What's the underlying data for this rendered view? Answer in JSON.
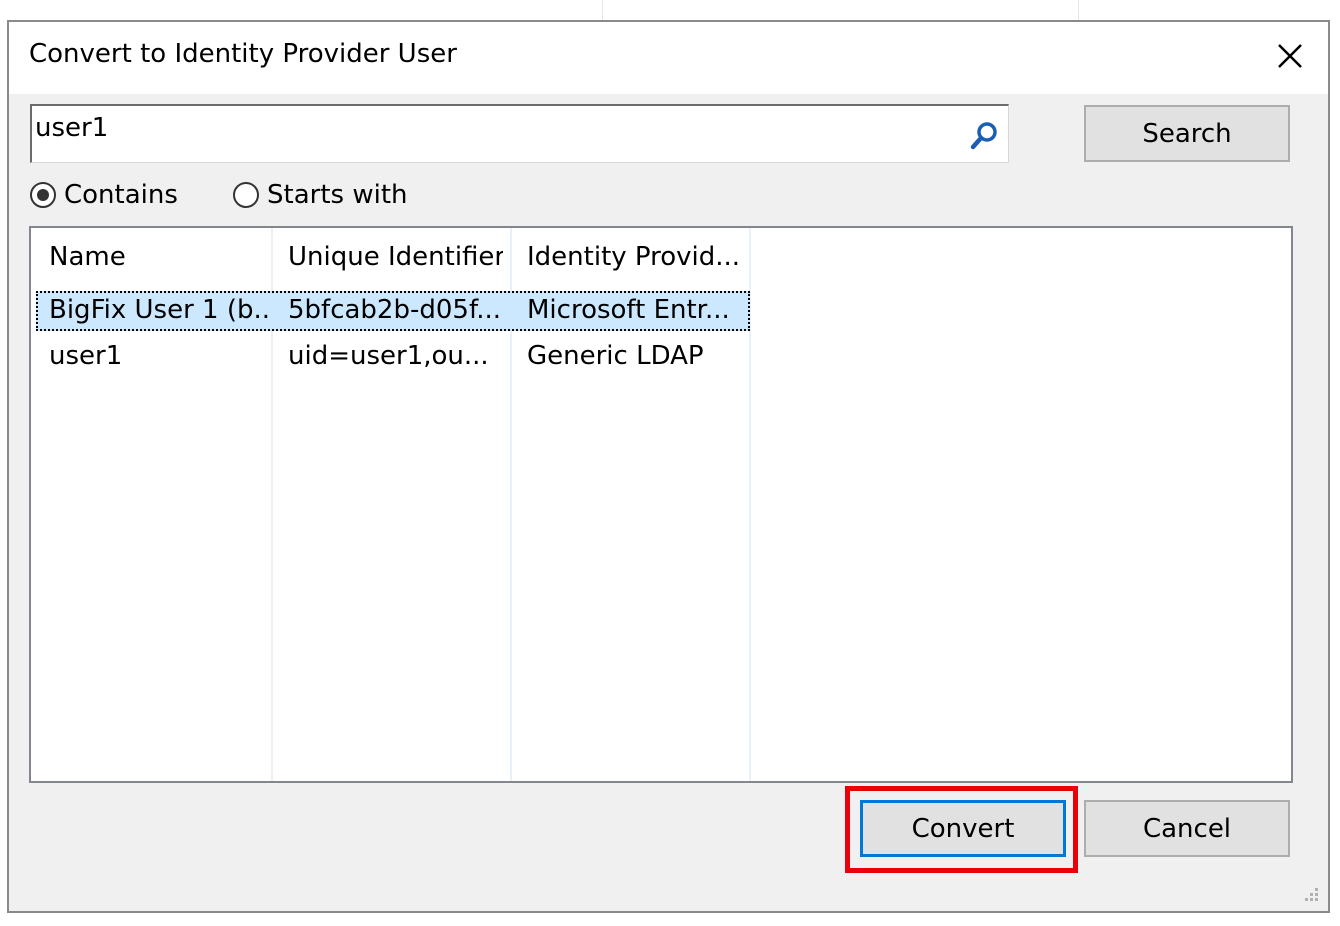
{
  "window": {
    "title": "Convert to Identity Provider User"
  },
  "search": {
    "value": "user1",
    "button_label": "Search"
  },
  "match_options": [
    {
      "label": "Contains",
      "selected": true
    },
    {
      "label": "Starts with",
      "selected": false
    }
  ],
  "results": {
    "columns": [
      "Name",
      "Unique Identifier",
      "Identity Provid..."
    ],
    "rows": [
      {
        "name": "BigFix User 1 (b...",
        "uid": "5bfcab2b-d05f...",
        "provider": "Microsoft Entr...",
        "selected": true
      },
      {
        "name": "user1",
        "uid": "uid=user1,ou...",
        "provider": "Generic LDAP",
        "selected": false
      }
    ]
  },
  "actions": {
    "convert_label": "Convert",
    "cancel_label": "Cancel"
  },
  "colors": {
    "highlight": "#e8000b",
    "default_button_border": "#0078d7",
    "selection": "#cce8ff"
  },
  "icons": {
    "close": "close-icon",
    "search": "search-icon",
    "resize": "resize-grip-icon"
  }
}
